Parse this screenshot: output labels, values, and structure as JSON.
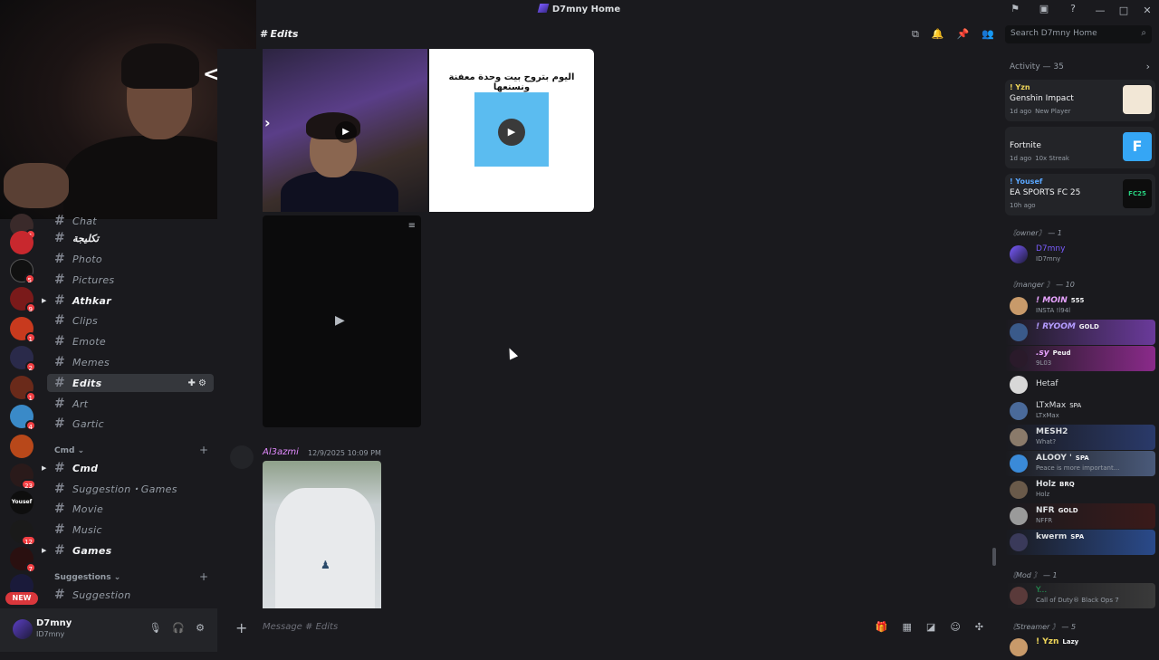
{
  "window": {
    "title": "D7mny Home"
  },
  "header": {
    "channel_title": "Edits",
    "search_placeholder": "Search D7mny Home"
  },
  "channels": [
    {
      "label": "Chat",
      "bold": false,
      "top": 0
    },
    {
      "label": "تكليجة",
      "bold": true,
      "top": 0
    },
    {
      "label": "Photo",
      "bold": false,
      "top": 0
    },
    {
      "label": "Pictures",
      "bold": false,
      "top": 0
    },
    {
      "label": "Athkar",
      "bold": true,
      "top": 0
    },
    {
      "label": "Clips",
      "bold": false,
      "top": 0
    },
    {
      "label": "Emote",
      "bold": false,
      "top": 0
    },
    {
      "label": "Memes",
      "bold": false,
      "top": 0
    },
    {
      "label": "Edits",
      "bold": true,
      "top": 0
    },
    {
      "label": "Art",
      "bold": false,
      "top": 0
    },
    {
      "label": "Gartic",
      "bold": false,
      "top": 0
    }
  ],
  "categories": [
    {
      "label": "Cmd"
    },
    {
      "label": "Suggestions"
    }
  ],
  "channels2": [
    {
      "label": "Cmd"
    },
    {
      "label": "Suggestion・Games"
    },
    {
      "label": "Movie"
    },
    {
      "label": "Music"
    },
    {
      "label": "Games"
    },
    {
      "label": "Suggestion"
    }
  ],
  "server_badges": [
    "1",
    "5",
    "9",
    "1",
    "2",
    "1",
    "4",
    "23",
    "12",
    "7"
  ],
  "server_label_yousef": "Yousef",
  "new_badge": "NEW",
  "user": {
    "name": "D7mny",
    "tag": "ID7mny"
  },
  "message": {
    "author": "Al3azmi",
    "time": "12/9/2025 10:09 PM",
    "arabic_caption": "اليوم بتروح بيت وحدة معفنة ونسنعها"
  },
  "composer": {
    "placeholder": "Message #",
    "channel": "Edits"
  },
  "activity": {
    "header": "Activity — 35",
    "cards": [
      {
        "user": "! Yzn",
        "game": "Genshin Impact",
        "time": "1d ago",
        "status": "New Player",
        "art_color": "#f2e7d6"
      },
      {
        "user": "",
        "game": "Fortnite",
        "time": "1d ago",
        "status": "10x Streak",
        "art_color": "#35a6f5"
      },
      {
        "user": "! Yousef",
        "game": "EA SPORTS FC 25",
        "time": "10h ago",
        "status": "",
        "art_color": "#0d0d0d"
      }
    ]
  },
  "roles": [
    {
      "label": "〘owner〙 — 1"
    },
    {
      "label": "〘manger 〙 — 10"
    },
    {
      "label": "〘Mod 〙 — 1"
    },
    {
      "label": "〘Streamer 〙 — 5"
    }
  ],
  "members": [
    {
      "name": "D7mny",
      "sub": "ID7mny",
      "color": "#7b5cff",
      "tag": ""
    },
    {
      "name": "! MOIN",
      "sub": "INSTA !l94l",
      "color": "#e8a3ff",
      "tag": "555"
    },
    {
      "name": "! RYOOM",
      "sub": "",
      "color": "#b49cff",
      "tag": "GOLD"
    },
    {
      "name": ".sy",
      "sub": "9L03",
      "color": "#e8a3ff",
      "tag": "Peud"
    },
    {
      "name": "Hetaf",
      "sub": "",
      "color": "#dbdee1",
      "tag": ""
    },
    {
      "name": "LTxMax",
      "sub": "LTxMax",
      "color": "#dbdee1",
      "tag": "SPA"
    },
    {
      "name": "MESH2",
      "sub": "What?",
      "color": "#dbdee1",
      "tag": ""
    },
    {
      "name": "ALOOY '",
      "sub": "Peace is more important...",
      "color": "#dbdee1",
      "tag": "SPA"
    },
    {
      "name": "Holz",
      "sub": "Holz",
      "color": "#dbdee1",
      "tag": "BRQ"
    },
    {
      "name": "NFR",
      "sub": "NFFR",
      "color": "#dbdee1",
      "tag": "GOLD"
    },
    {
      "name": "kwerm",
      "sub": "",
      "color": "#dbdee1",
      "tag": "SPA"
    },
    {
      "name": "Y...",
      "sub": "Call of Duty® Black Ops 7",
      "color": "#23a55a",
      "tag": ""
    },
    {
      "name": "! Yzn",
      "sub": "",
      "color": "#f0d75a",
      "tag": "Lazy"
    }
  ]
}
